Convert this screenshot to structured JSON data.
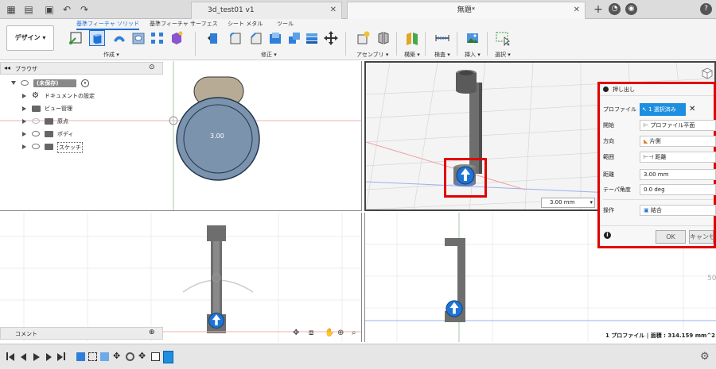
{
  "titlebar": {
    "tabs": [
      {
        "label": "3d_test01 v1"
      },
      {
        "label": "無題*"
      }
    ]
  },
  "ribbon": {
    "design_label": "デザイン",
    "tabs": [
      "基準フィーチャ ソリッド",
      "基準フィーチャ サーフェス",
      "シート メタル",
      "ツール"
    ],
    "groups": [
      "作成",
      "修正",
      "アセンブリ",
      "構築",
      "検査",
      "挿入",
      "選択"
    ]
  },
  "browser": {
    "title": "ブラウザ",
    "root": "(未保存)",
    "items": [
      "ドキュメントの設定",
      "ビュー管理",
      "原点",
      "ボディ",
      "スケッチ"
    ]
  },
  "comment": {
    "label": "コメント"
  },
  "sketch": {
    "dimension": "3.00"
  },
  "viewport": {
    "distance_input": "3.00 mm",
    "ruler_label": "50"
  },
  "dialog": {
    "title": "押し出し",
    "rows": [
      {
        "label": "プロファイル",
        "value": "1 選択済み"
      },
      {
        "label": "開始",
        "value": "プロファイル平面"
      },
      {
        "label": "方向",
        "value": "片側"
      },
      {
        "label": "範囲",
        "value": "距離"
      },
      {
        "label": "距離",
        "value": "3.00 mm"
      },
      {
        "label": "テーパ角度",
        "value": "0.0 deg"
      },
      {
        "label": "操作",
        "value": "結合"
      }
    ],
    "ok": "OK",
    "cancel": "キャンセル"
  },
  "status": {
    "profile_info": "1 プロファイル | 面積 : 314.159 mm^2"
  },
  "colors": {
    "accent": "#1e6fd0",
    "highlight": "#e00000",
    "body": "#6e6e6e",
    "sketch_fill": "#7b93ad"
  }
}
